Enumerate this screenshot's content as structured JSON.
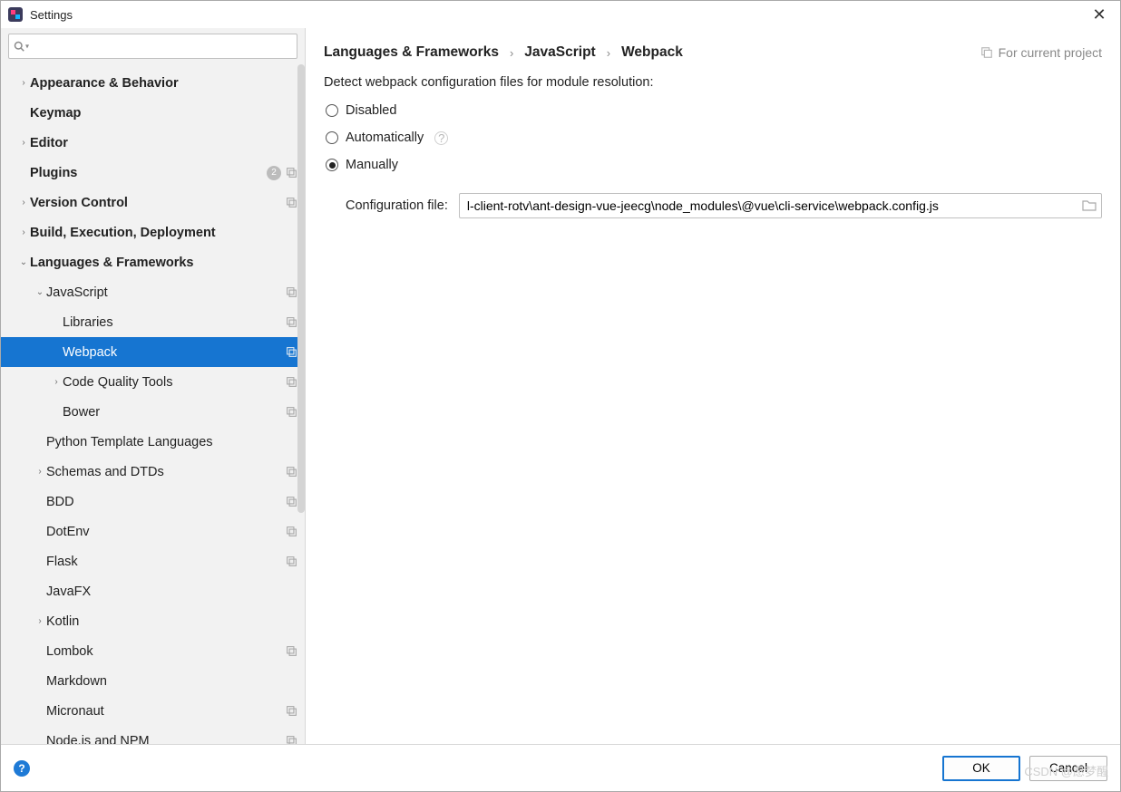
{
  "window": {
    "title": "Settings"
  },
  "search": {
    "placeholder": ""
  },
  "sidebar": {
    "items": [
      {
        "label": "Appearance & Behavior",
        "depth": 0,
        "arrow": "right",
        "bold": true
      },
      {
        "label": "Keymap",
        "depth": 0,
        "arrow": "",
        "bold": true
      },
      {
        "label": "Editor",
        "depth": 0,
        "arrow": "right",
        "bold": true
      },
      {
        "label": "Plugins",
        "depth": 0,
        "arrow": "",
        "bold": true,
        "badge": "2",
        "proj": true
      },
      {
        "label": "Version Control",
        "depth": 0,
        "arrow": "right",
        "bold": true,
        "proj": true
      },
      {
        "label": "Build, Execution, Deployment",
        "depth": 0,
        "arrow": "right",
        "bold": true
      },
      {
        "label": "Languages & Frameworks",
        "depth": 0,
        "arrow": "down",
        "bold": true
      },
      {
        "label": "JavaScript",
        "depth": 1,
        "arrow": "down",
        "proj": true
      },
      {
        "label": "Libraries",
        "depth": 2,
        "arrow": "",
        "proj": true
      },
      {
        "label": "Webpack",
        "depth": 2,
        "arrow": "",
        "proj": true,
        "selected": true
      },
      {
        "label": "Code Quality Tools",
        "depth": 2,
        "arrow": "right",
        "proj": true
      },
      {
        "label": "Bower",
        "depth": 2,
        "arrow": "",
        "proj": true
      },
      {
        "label": "Python Template Languages",
        "depth": 1,
        "arrow": ""
      },
      {
        "label": "Schemas and DTDs",
        "depth": 1,
        "arrow": "right",
        "proj": true
      },
      {
        "label": "BDD",
        "depth": 1,
        "arrow": "",
        "proj": true
      },
      {
        "label": "DotEnv",
        "depth": 1,
        "arrow": "",
        "proj": true
      },
      {
        "label": "Flask",
        "depth": 1,
        "arrow": "",
        "proj": true
      },
      {
        "label": "JavaFX",
        "depth": 1,
        "arrow": ""
      },
      {
        "label": "Kotlin",
        "depth": 1,
        "arrow": "right"
      },
      {
        "label": "Lombok",
        "depth": 1,
        "arrow": "",
        "proj": true
      },
      {
        "label": "Markdown",
        "depth": 1,
        "arrow": ""
      },
      {
        "label": "Micronaut",
        "depth": 1,
        "arrow": "",
        "proj": true
      },
      {
        "label": "Node.js and NPM",
        "depth": 1,
        "arrow": "",
        "proj": true
      }
    ]
  },
  "breadcrumbs": {
    "a": "Languages & Frameworks",
    "b": "JavaScript",
    "c": "Webpack",
    "sep": "›"
  },
  "scope": {
    "label": "For current project"
  },
  "content": {
    "legend": "Detect webpack configuration files for module resolution:",
    "radios": {
      "disabled": "Disabled",
      "auto": "Automatically",
      "manual": "Manually"
    },
    "selected": "manual",
    "cfg_label": "Configuration file:",
    "cfg_value": "l-client-rotv\\ant-design-vue-jeecg\\node_modules\\@vue\\cli-service\\webpack.config.js"
  },
  "footer": {
    "ok": "OK",
    "cancel": "Cancel"
  },
  "watermark": "CSDN @愿梦醒"
}
